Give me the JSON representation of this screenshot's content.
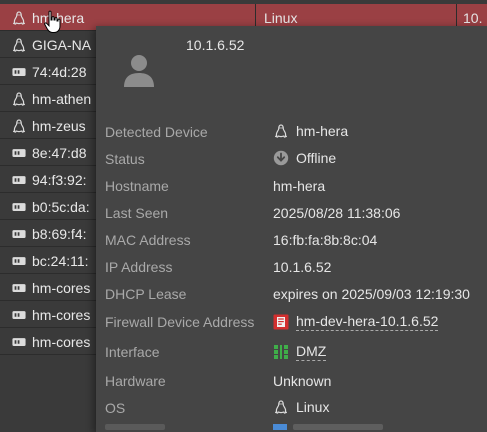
{
  "device_rows": [
    {
      "name": "hm-hera",
      "icon": "linux-icon",
      "os": "Linux",
      "ip": "10.",
      "selected": true
    },
    {
      "name": "GIGA-NA",
      "icon": "linux-icon"
    },
    {
      "name": "74:4d:28",
      "icon": "network-device-icon"
    },
    {
      "name": "hm-athen",
      "icon": "linux-icon"
    },
    {
      "name": "hm-zeus",
      "icon": "linux-icon"
    },
    {
      "name": "8e:47:d8",
      "icon": "network-device-icon"
    },
    {
      "name": "94:f3:92:",
      "icon": "network-device-icon"
    },
    {
      "name": "b0:5c:da:",
      "icon": "network-device-icon"
    },
    {
      "name": "b8:69:f4:",
      "icon": "network-device-icon"
    },
    {
      "name": "bc:24:11:",
      "icon": "network-device-icon"
    },
    {
      "name": "hm-cores",
      "icon": "network-device-icon"
    },
    {
      "name": "hm-cores",
      "icon": "network-device-icon"
    },
    {
      "name": "hm-cores",
      "icon": "network-device-icon"
    }
  ],
  "tooltip": {
    "ip_header": "10.1.6.52",
    "fields": [
      {
        "label": "Detected Device",
        "value": "hm-hera",
        "icon": "linux-icon"
      },
      {
        "label": "Status",
        "value": "Offline",
        "icon": "offline-arrow-icon"
      },
      {
        "label": "Hostname",
        "value": "hm-hera"
      },
      {
        "label": "Last Seen",
        "value": "2025/08/28 11:38:06"
      },
      {
        "label": "MAC Address",
        "value": "16:fb:fa:8b:8c:04"
      },
      {
        "label": "IP Address",
        "value": "10.1.6.52"
      },
      {
        "label": "DHCP Lease",
        "value": "expires on 2025/09/03 12:19:30"
      },
      {
        "label": "Firewall Device Address",
        "value": "hm-dev-hera-10.1.6.52",
        "icon": "address-object-icon",
        "link": true
      },
      {
        "label": "Interface",
        "value": "DMZ",
        "icon": "interface-port-icon",
        "link": true
      },
      {
        "label": "Hardware",
        "value": "Unknown"
      },
      {
        "label": "OS",
        "value": "Linux",
        "icon": "linux-icon"
      }
    ]
  },
  "colors": {
    "selected_row": "#9a4044",
    "background": "#3a3a3a",
    "tooltip_bg": "#454545",
    "address_icon": "#d32f2f",
    "interface_icon": "#3fae49"
  }
}
